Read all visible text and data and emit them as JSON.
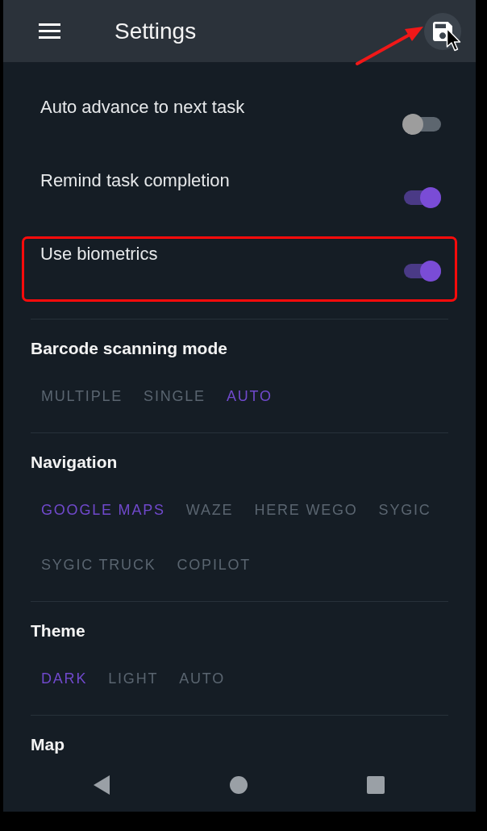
{
  "app_bar": {
    "title": "Settings",
    "save_pointed": true,
    "cursor_on_save": true
  },
  "toggles": [
    {
      "label": "Auto advance to next task",
      "on": false,
      "highlighted": false
    },
    {
      "label": "Remind task completion",
      "on": true,
      "highlighted": false
    },
    {
      "label": "Use biometrics",
      "on": true,
      "highlighted": true
    }
  ],
  "sections": [
    {
      "title": "Barcode scanning mode",
      "options": [
        {
          "label": "MULTIPLE",
          "selected": false
        },
        {
          "label": "SINGLE",
          "selected": false
        },
        {
          "label": "AUTO",
          "selected": true
        }
      ]
    },
    {
      "title": "Navigation",
      "options": [
        {
          "label": "GOOGLE MAPS",
          "selected": true
        },
        {
          "label": "WAZE",
          "selected": false
        },
        {
          "label": "HERE WEGO",
          "selected": false
        },
        {
          "label": "SYGIC",
          "selected": false
        },
        {
          "label": "SYGIC TRUCK",
          "selected": false
        },
        {
          "label": "COPILOT",
          "selected": false
        }
      ]
    },
    {
      "title": "Theme",
      "options": [
        {
          "label": "DARK",
          "selected": true
        },
        {
          "label": "LIGHT",
          "selected": false
        },
        {
          "label": "AUTO",
          "selected": false
        }
      ]
    },
    {
      "title": "Map"
    }
  ]
}
